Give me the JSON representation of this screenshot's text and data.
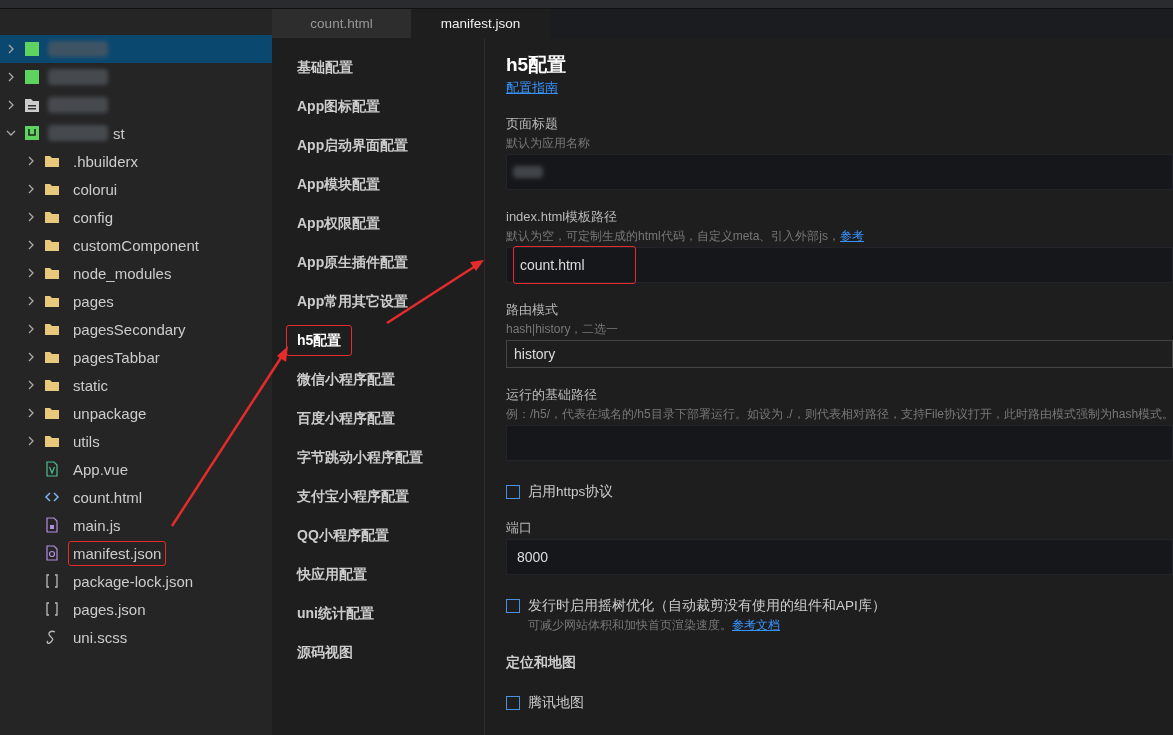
{
  "tabs": [
    {
      "label": "count.html",
      "selected": false
    },
    {
      "label": "manifest.json",
      "selected": true
    }
  ],
  "tree": [
    {
      "kind": "project",
      "blurred": true,
      "selected": true,
      "expanded": false
    },
    {
      "kind": "project",
      "blurred": true,
      "selected": false,
      "expanded": false
    },
    {
      "kind": "folder-group",
      "blurred": true,
      "selected": false,
      "expanded": false
    },
    {
      "kind": "uni-project",
      "label": "st",
      "blurred": true,
      "selected": false,
      "expanded": true,
      "children": [
        {
          "kind": "folder",
          "label": ".hbuilderx",
          "highlighted": false
        },
        {
          "kind": "folder",
          "label": "colorui",
          "highlighted": false
        },
        {
          "kind": "folder",
          "label": "config",
          "highlighted": false
        },
        {
          "kind": "folder",
          "label": "customComponent",
          "highlighted": false
        },
        {
          "kind": "folder",
          "label": "node_modules",
          "highlighted": false
        },
        {
          "kind": "folder",
          "label": "pages",
          "highlighted": false
        },
        {
          "kind": "folder",
          "label": "pagesSecondary",
          "highlighted": false
        },
        {
          "kind": "folder",
          "label": "pagesTabbar",
          "highlighted": false
        },
        {
          "kind": "folder",
          "label": "static",
          "highlighted": false
        },
        {
          "kind": "folder",
          "label": "unpackage",
          "highlighted": false
        },
        {
          "kind": "folder",
          "label": "utils",
          "highlighted": false
        },
        {
          "kind": "vue",
          "label": "App.vue",
          "highlighted": false
        },
        {
          "kind": "html",
          "label": "count.html",
          "highlighted": false
        },
        {
          "kind": "js",
          "label": "main.js",
          "highlighted": false
        },
        {
          "kind": "manifest",
          "label": "manifest.json",
          "highlighted": true
        },
        {
          "kind": "json",
          "label": "package-lock.json",
          "highlighted": false
        },
        {
          "kind": "json",
          "label": "pages.json",
          "highlighted": false
        },
        {
          "kind": "scss",
          "label": "uni.scss",
          "highlighted": false
        }
      ]
    }
  ],
  "nav": [
    {
      "label": "基础配置",
      "selected": false
    },
    {
      "label": "App图标配置",
      "selected": false
    },
    {
      "label": "App启动界面配置",
      "selected": false
    },
    {
      "label": "App模块配置",
      "selected": false
    },
    {
      "label": "App权限配置",
      "selected": false
    },
    {
      "label": "App原生插件配置",
      "selected": false
    },
    {
      "label": "App常用其它设置",
      "selected": false
    },
    {
      "label": "h5配置",
      "selected": true
    },
    {
      "label": "微信小程序配置",
      "selected": false
    },
    {
      "label": "百度小程序配置",
      "selected": false
    },
    {
      "label": "字节跳动小程序配置",
      "selected": false
    },
    {
      "label": "支付宝小程序配置",
      "selected": false
    },
    {
      "label": "QQ小程序配置",
      "selected": false
    },
    {
      "label": "快应用配置",
      "selected": false
    },
    {
      "label": "uni统计配置",
      "selected": false
    },
    {
      "label": "源码视图",
      "selected": false
    }
  ],
  "section": {
    "title": "h5配置",
    "link": "配置指南"
  },
  "fields": [
    {
      "kind": "text",
      "label": "页面标题",
      "hint": "默认为应用名称",
      "blurred": true
    },
    {
      "kind": "text",
      "label": "index.html模板路径",
      "hint": "默认为空，可定制生成的html代码，自定义meta、引入外部js，",
      "hint_link": "参考",
      "value": "count.html",
      "highlighted": true
    },
    {
      "kind": "select",
      "label": "路由模式",
      "hint": "hash|history，二选一",
      "value": "history"
    },
    {
      "kind": "text",
      "label": "运行的基础路径",
      "hint": "例：/h5/，代表在域名的/h5目录下部署运行。如设为 ./，则代表相对路径，支持File协议打开，此时路由模式强制为hash模式。"
    },
    {
      "kind": "checkbox",
      "label": "启用https协议",
      "checked": false
    },
    {
      "kind": "text",
      "label": "端口",
      "value": "8000"
    },
    {
      "kind": "checkbox",
      "label": "发行时启用摇树优化（自动裁剪没有使用的组件和API库）",
      "hint": "可减少网站体积和加快首页渲染速度。",
      "hint_link": "参考文档",
      "checked": false
    },
    {
      "kind": "heading",
      "label": "定位和地图"
    },
    {
      "kind": "checkbox",
      "label": "腾讯地图",
      "checked": false
    }
  ]
}
